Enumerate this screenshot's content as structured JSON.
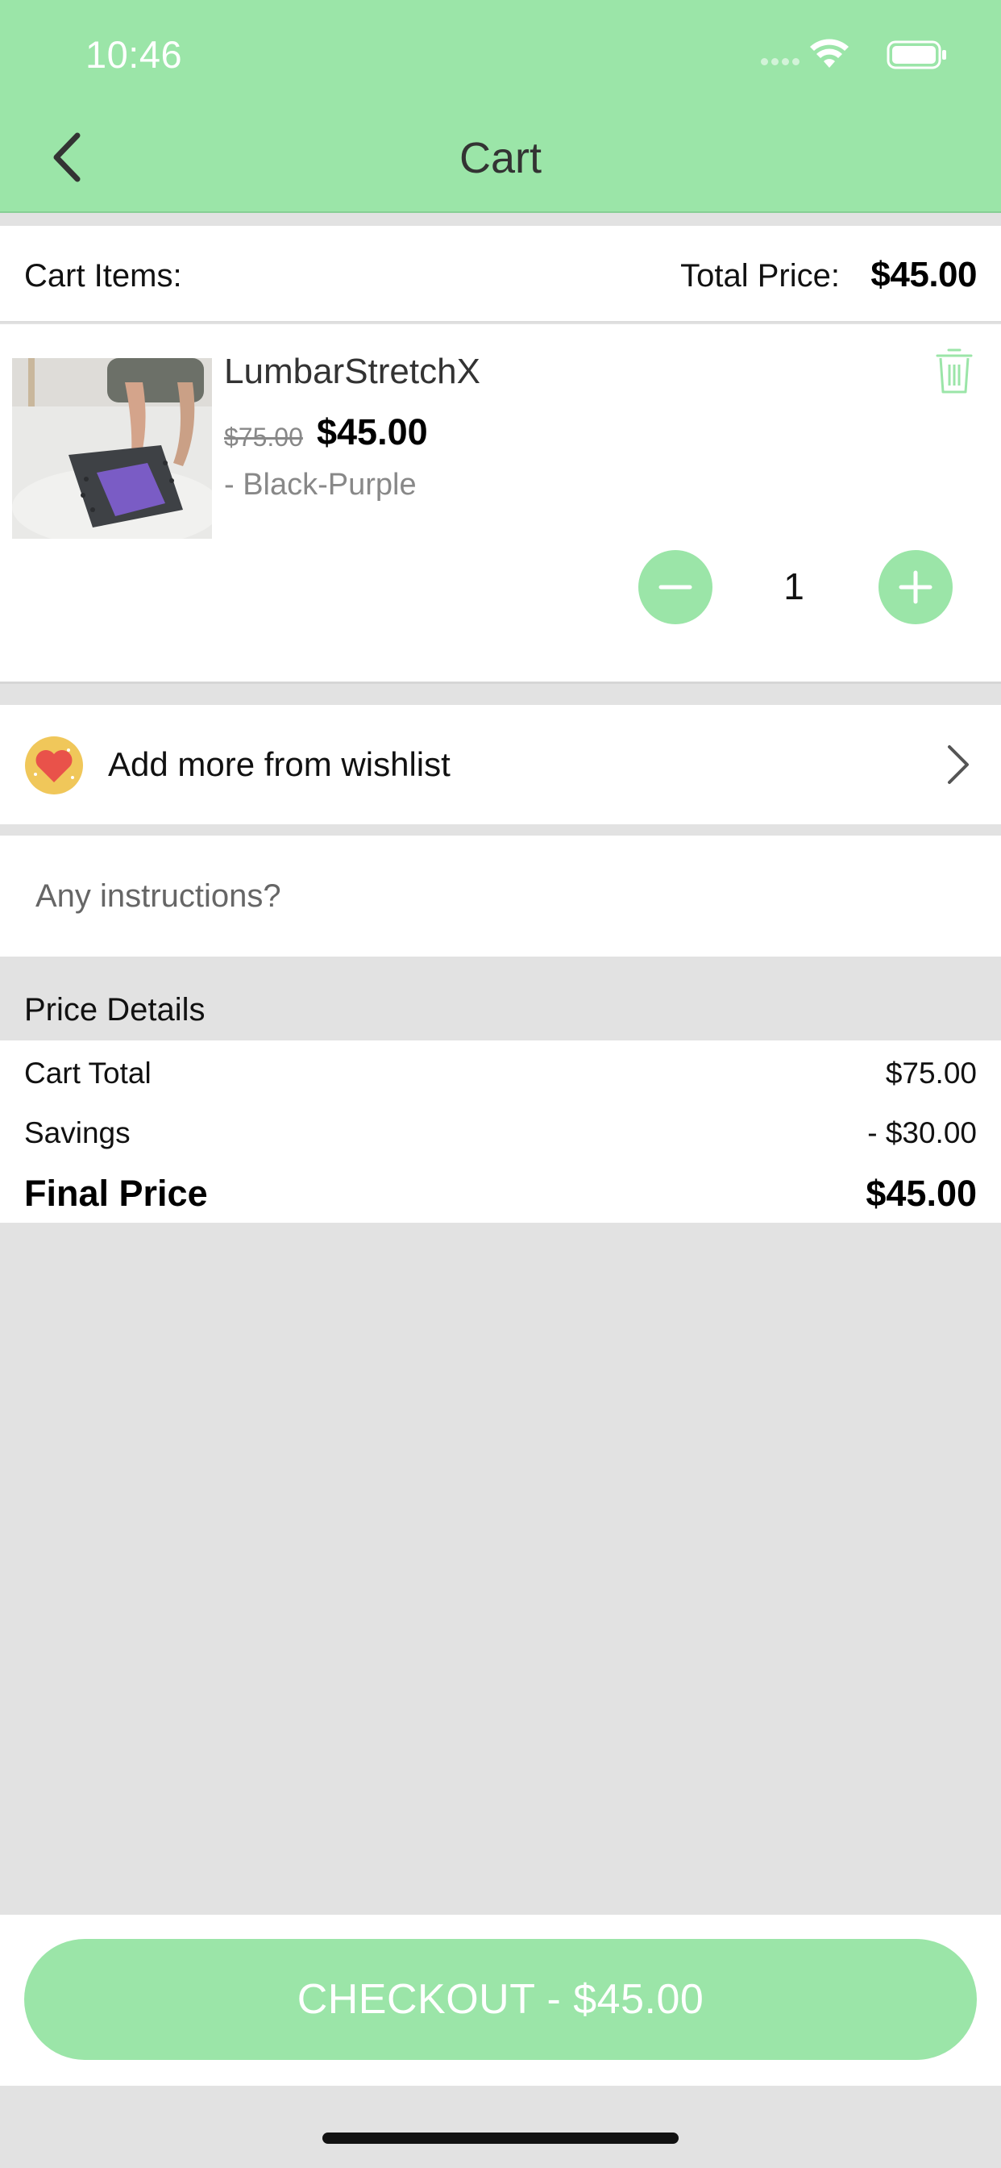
{
  "status_bar": {
    "time": "10:46"
  },
  "nav": {
    "title": "Cart"
  },
  "summary": {
    "items_label": "Cart Items:",
    "total_label": "Total Price:",
    "total_value": "$45.00"
  },
  "cart_item": {
    "name": "LumbarStretchX",
    "original_price": "$75.00",
    "price": "$45.00",
    "variant": "- Black-Purple",
    "quantity": "1"
  },
  "wishlist": {
    "label": "Add more from wishlist"
  },
  "instructions": {
    "placeholder": "Any instructions?"
  },
  "price_details": {
    "heading": "Price Details",
    "rows": [
      {
        "label": "Cart Total",
        "value": "$75.00"
      },
      {
        "label": "Savings",
        "value": "- $30.00"
      },
      {
        "label": "Final Price",
        "value": "$45.00"
      }
    ]
  },
  "checkout": {
    "label": "CHECKOUT - $45.00"
  },
  "colors": {
    "accent": "#9be5a8",
    "wishlist_circle": "#f0c75a",
    "heart": "#e9524a"
  },
  "icons": {
    "back": "chevron-left-icon",
    "delete": "trash-icon",
    "decrease": "minus-icon",
    "increase": "plus-icon",
    "wishlist": "heart-icon",
    "chevron": "chevron-right-icon"
  }
}
